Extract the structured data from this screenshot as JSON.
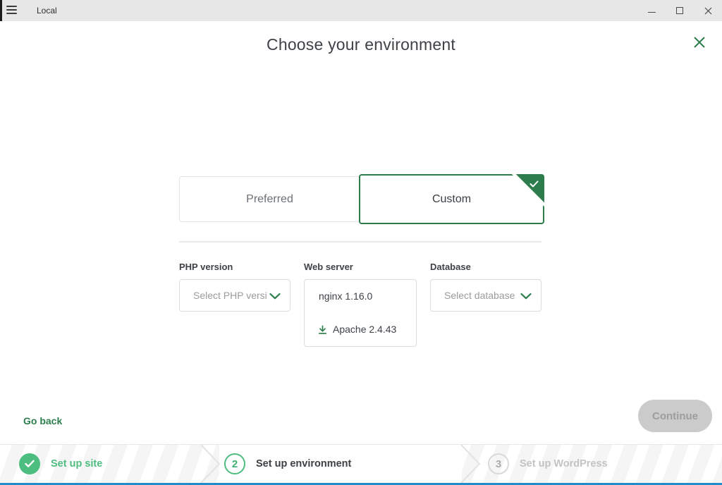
{
  "titlebar": {
    "app_title": "Local"
  },
  "modal": {
    "title": "Choose your environment"
  },
  "tabs": [
    {
      "label": "Preferred",
      "selected": false
    },
    {
      "label": "Custom",
      "selected": true
    }
  ],
  "form": {
    "php": {
      "label": "PHP version",
      "placeholder": "Select PHP versi..."
    },
    "web_server": {
      "label": "Web server",
      "selected_option": "nginx 1.16.0",
      "download_option": "Apache 2.4.43"
    },
    "database": {
      "label": "Database",
      "placeholder": "Select database"
    }
  },
  "actions": {
    "go_back": "Go back",
    "continue_label": "Continue",
    "continue_enabled": false
  },
  "stepper": {
    "steps": [
      {
        "icon": "check-icon",
        "label": "Set up site",
        "state": "complete"
      },
      {
        "number": "2",
        "label": "Set up environment",
        "state": "active"
      },
      {
        "number": "3",
        "label": "Set up WordPress",
        "state": "upcoming"
      }
    ]
  },
  "icons": {
    "hamburger": "menu",
    "minimize": "minimize",
    "maximize": "maximize",
    "close": "close",
    "chevron_down": "chevron-down",
    "download": "download",
    "check": "check"
  },
  "colors": {
    "green_dark": "#2d7d4c",
    "green_light": "#4ebd80",
    "footer_accent_blue": "#1f8dc9",
    "disabled_button_gray": "#cbcbcb",
    "titlebar_gray": "#e7e7e7"
  }
}
